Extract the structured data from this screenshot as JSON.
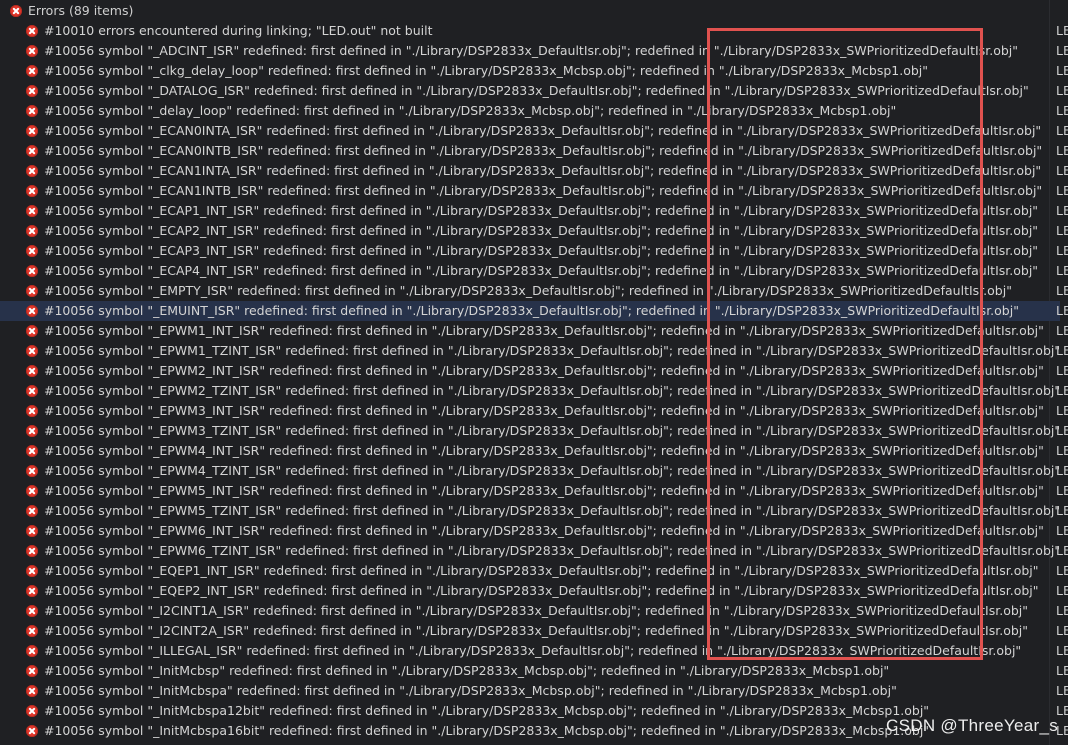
{
  "header": {
    "label": "Errors (89 items)",
    "resource": ""
  },
  "rows": [
    {
      "text": "#10010 errors encountered during linking; \"LED.out\" not built",
      "resource": "LE",
      "selected": false
    },
    {
      "text": "#10056 symbol \"_ADCINT_ISR\" redefined: first defined in \"./Library/DSP2833x_DefaultIsr.obj\"; redefined in \"./Library/DSP2833x_SWPrioritizedDefaultIsr.obj\"",
      "resource": "LE",
      "selected": false
    },
    {
      "text": "#10056 symbol \"_clkg_delay_loop\" redefined: first defined in \"./Library/DSP2833x_Mcbsp.obj\"; redefined in \"./Library/DSP2833x_Mcbsp1.obj\"",
      "resource": "LE",
      "selected": false
    },
    {
      "text": "#10056 symbol \"_DATALOG_ISR\" redefined: first defined in \"./Library/DSP2833x_DefaultIsr.obj\"; redefined in \"./Library/DSP2833x_SWPrioritizedDefaultIsr.obj\"",
      "resource": "LE",
      "selected": false
    },
    {
      "text": "#10056 symbol \"_delay_loop\" redefined: first defined in \"./Library/DSP2833x_Mcbsp.obj\"; redefined in \"./Library/DSP2833x_Mcbsp1.obj\"",
      "resource": "LE",
      "selected": false
    },
    {
      "text": "#10056 symbol \"_ECAN0INTA_ISR\" redefined: first defined in \"./Library/DSP2833x_DefaultIsr.obj\"; redefined in \"./Library/DSP2833x_SWPrioritizedDefaultIsr.obj\"",
      "resource": "LE",
      "selected": false
    },
    {
      "text": "#10056 symbol \"_ECAN0INTB_ISR\" redefined: first defined in \"./Library/DSP2833x_DefaultIsr.obj\"; redefined in \"./Library/DSP2833x_SWPrioritizedDefaultIsr.obj\"",
      "resource": "LE",
      "selected": false
    },
    {
      "text": "#10056 symbol \"_ECAN1INTA_ISR\" redefined: first defined in \"./Library/DSP2833x_DefaultIsr.obj\"; redefined in \"./Library/DSP2833x_SWPrioritizedDefaultIsr.obj\"",
      "resource": "LE",
      "selected": false
    },
    {
      "text": "#10056 symbol \"_ECAN1INTB_ISR\" redefined: first defined in \"./Library/DSP2833x_DefaultIsr.obj\"; redefined in \"./Library/DSP2833x_SWPrioritizedDefaultIsr.obj\"",
      "resource": "LE",
      "selected": false
    },
    {
      "text": "#10056 symbol \"_ECAP1_INT_ISR\" redefined: first defined in \"./Library/DSP2833x_DefaultIsr.obj\"; redefined in \"./Library/DSP2833x_SWPrioritizedDefaultIsr.obj\"",
      "resource": "LE",
      "selected": false
    },
    {
      "text": "#10056 symbol \"_ECAP2_INT_ISR\" redefined: first defined in \"./Library/DSP2833x_DefaultIsr.obj\"; redefined in \"./Library/DSP2833x_SWPrioritizedDefaultIsr.obj\"",
      "resource": "LE",
      "selected": false
    },
    {
      "text": "#10056 symbol \"_ECAP3_INT_ISR\" redefined: first defined in \"./Library/DSP2833x_DefaultIsr.obj\"; redefined in \"./Library/DSP2833x_SWPrioritizedDefaultIsr.obj\"",
      "resource": "LE",
      "selected": false
    },
    {
      "text": "#10056 symbol \"_ECAP4_INT_ISR\" redefined: first defined in \"./Library/DSP2833x_DefaultIsr.obj\"; redefined in \"./Library/DSP2833x_SWPrioritizedDefaultIsr.obj\"",
      "resource": "LE",
      "selected": false
    },
    {
      "text": "#10056 symbol \"_EMPTY_ISR\" redefined: first defined in \"./Library/DSP2833x_DefaultIsr.obj\"; redefined in \"./Library/DSP2833x_SWPrioritizedDefaultIsr.obj\"",
      "resource": "LE",
      "selected": false
    },
    {
      "text": "#10056 symbol \"_EMUINT_ISR\" redefined: first defined in \"./Library/DSP2833x_DefaultIsr.obj\"; redefined in \"./Library/DSP2833x_SWPrioritizedDefaultIsr.obj\"",
      "resource": "LE",
      "selected": true
    },
    {
      "text": "#10056 symbol \"_EPWM1_INT_ISR\" redefined: first defined in \"./Library/DSP2833x_DefaultIsr.obj\"; redefined in \"./Library/DSP2833x_SWPrioritizedDefaultIsr.obj\"",
      "resource": "LE",
      "selected": false
    },
    {
      "text": "#10056 symbol \"_EPWM1_TZINT_ISR\" redefined: first defined in \"./Library/DSP2833x_DefaultIsr.obj\"; redefined in \"./Library/DSP2833x_SWPrioritizedDefaultIsr.obj\"",
      "resource": "LE",
      "selected": false
    },
    {
      "text": "#10056 symbol \"_EPWM2_INT_ISR\" redefined: first defined in \"./Library/DSP2833x_DefaultIsr.obj\"; redefined in \"./Library/DSP2833x_SWPrioritizedDefaultIsr.obj\"",
      "resource": "LE",
      "selected": false
    },
    {
      "text": "#10056 symbol \"_EPWM2_TZINT_ISR\" redefined: first defined in \"./Library/DSP2833x_DefaultIsr.obj\"; redefined in \"./Library/DSP2833x_SWPrioritizedDefaultIsr.obj\"",
      "resource": "LE",
      "selected": false
    },
    {
      "text": "#10056 symbol \"_EPWM3_INT_ISR\" redefined: first defined in \"./Library/DSP2833x_DefaultIsr.obj\"; redefined in \"./Library/DSP2833x_SWPrioritizedDefaultIsr.obj\"",
      "resource": "LE",
      "selected": false
    },
    {
      "text": "#10056 symbol \"_EPWM3_TZINT_ISR\" redefined: first defined in \"./Library/DSP2833x_DefaultIsr.obj\"; redefined in \"./Library/DSP2833x_SWPrioritizedDefaultIsr.obj\"",
      "resource": "LE",
      "selected": false
    },
    {
      "text": "#10056 symbol \"_EPWM4_INT_ISR\" redefined: first defined in \"./Library/DSP2833x_DefaultIsr.obj\"; redefined in \"./Library/DSP2833x_SWPrioritizedDefaultIsr.obj\"",
      "resource": "LE",
      "selected": false
    },
    {
      "text": "#10056 symbol \"_EPWM4_TZINT_ISR\" redefined: first defined in \"./Library/DSP2833x_DefaultIsr.obj\"; redefined in \"./Library/DSP2833x_SWPrioritizedDefaultIsr.obj\"",
      "resource": "LE",
      "selected": false
    },
    {
      "text": "#10056 symbol \"_EPWM5_INT_ISR\" redefined: first defined in \"./Library/DSP2833x_DefaultIsr.obj\"; redefined in \"./Library/DSP2833x_SWPrioritizedDefaultIsr.obj\"",
      "resource": "LE",
      "selected": false
    },
    {
      "text": "#10056 symbol \"_EPWM5_TZINT_ISR\" redefined: first defined in \"./Library/DSP2833x_DefaultIsr.obj\"; redefined in \"./Library/DSP2833x_SWPrioritizedDefaultIsr.obj\"",
      "resource": "LE",
      "selected": false
    },
    {
      "text": "#10056 symbol \"_EPWM6_INT_ISR\" redefined: first defined in \"./Library/DSP2833x_DefaultIsr.obj\"; redefined in \"./Library/DSP2833x_SWPrioritizedDefaultIsr.obj\"",
      "resource": "LE",
      "selected": false
    },
    {
      "text": "#10056 symbol \"_EPWM6_TZINT_ISR\" redefined: first defined in \"./Library/DSP2833x_DefaultIsr.obj\"; redefined in \"./Library/DSP2833x_SWPrioritizedDefaultIsr.obj\"",
      "resource": "LE",
      "selected": false
    },
    {
      "text": "#10056 symbol \"_EQEP1_INT_ISR\" redefined: first defined in \"./Library/DSP2833x_DefaultIsr.obj\"; redefined in \"./Library/DSP2833x_SWPrioritizedDefaultIsr.obj\"",
      "resource": "LE",
      "selected": false
    },
    {
      "text": "#10056 symbol \"_EQEP2_INT_ISR\" redefined: first defined in \"./Library/DSP2833x_DefaultIsr.obj\"; redefined in \"./Library/DSP2833x_SWPrioritizedDefaultIsr.obj\"",
      "resource": "LE",
      "selected": false
    },
    {
      "text": "#10056 symbol \"_I2CINT1A_ISR\" redefined: first defined in \"./Library/DSP2833x_DefaultIsr.obj\"; redefined in \"./Library/DSP2833x_SWPrioritizedDefaultIsr.obj\"",
      "resource": "LE",
      "selected": false
    },
    {
      "text": "#10056 symbol \"_I2CINT2A_ISR\" redefined: first defined in \"./Library/DSP2833x_DefaultIsr.obj\"; redefined in \"./Library/DSP2833x_SWPrioritizedDefaultIsr.obj\"",
      "resource": "LE",
      "selected": false
    },
    {
      "text": "#10056 symbol \"_ILLEGAL_ISR\" redefined: first defined in \"./Library/DSP2833x_DefaultIsr.obj\"; redefined in \"./Library/DSP2833x_SWPrioritizedDefaultIsr.obj\"",
      "resource": "LE",
      "selected": false
    },
    {
      "text": "#10056 symbol \"_InitMcbsp\" redefined: first defined in \"./Library/DSP2833x_Mcbsp.obj\"; redefined in \"./Library/DSP2833x_Mcbsp1.obj\"",
      "resource": "LE",
      "selected": false
    },
    {
      "text": "#10056 symbol \"_InitMcbspa\" redefined: first defined in \"./Library/DSP2833x_Mcbsp.obj\"; redefined in \"./Library/DSP2833x_Mcbsp1.obj\"",
      "resource": "LE",
      "selected": false
    },
    {
      "text": "#10056 symbol \"_InitMcbspa12bit\" redefined: first defined in \"./Library/DSP2833x_Mcbsp.obj\"; redefined in \"./Library/DSP2833x_Mcbsp1.obj\"",
      "resource": "LE",
      "selected": false
    },
    {
      "text": "#10056 symbol \"_InitMcbspa16bit\" redefined: first defined in \"./Library/DSP2833x_Mcbsp.obj\"; redefined in \"./Library/DSP2833x_Mcbsp1.obj\"",
      "resource": "LE",
      "selected": false
    }
  ],
  "watermark": "CSDN @ThreeYear_s",
  "colors": {
    "background": "#1f2023",
    "text": "#d4d4d4",
    "error_icon": "#e2382c",
    "selection": "#27324a",
    "highlight_box": "#e0524f"
  },
  "icons": {
    "header": "error-icon",
    "row": "error-icon",
    "expander": "chevron-down-icon"
  }
}
